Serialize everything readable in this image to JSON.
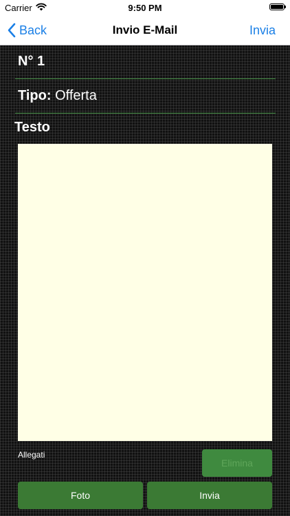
{
  "status_bar": {
    "carrier": "Carrier",
    "time": "9:50 PM",
    "icons": [
      "wifi-icon",
      "battery-icon"
    ]
  },
  "nav": {
    "back_label": "Back",
    "title": "Invio E-Mail",
    "action_label": "Invia",
    "accent_color": "#1a7fe6"
  },
  "form": {
    "number_label": "N° 1",
    "tipo_key": "Tipo:",
    "tipo_value": "Offerta",
    "testo_label": "Testo",
    "testo_value": "",
    "allegati_label": "Allegati"
  },
  "buttons": {
    "elimina": "Elimina",
    "foto": "Foto",
    "invia": "Invia"
  },
  "colors": {
    "background": "#111111",
    "divider": "#3f8a3f",
    "button": "#3b7a34",
    "text_area": "#ffffe6"
  }
}
